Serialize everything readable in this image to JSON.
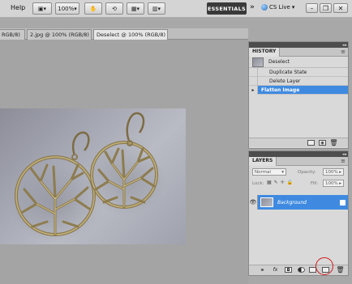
{
  "menubar": {
    "help_label": "Help",
    "zoom_value": "100%",
    "workspace_label": "ESSENTIALS",
    "more_label": "»",
    "cslive_label": "CS Live"
  },
  "tabs": [
    {
      "label": "RGB/8)",
      "close": "×"
    },
    {
      "label": "2.jpg @ 100% (RGB/8)",
      "close": "×"
    },
    {
      "label": "Deselect @ 100% (RGB/8)",
      "close": "×"
    }
  ],
  "history": {
    "title": "HISTORY",
    "snapshot_label": "Deselect",
    "items": [
      {
        "label": "Duplicate State"
      },
      {
        "label": "Delete Layer"
      },
      {
        "label": "Flatten Image"
      }
    ]
  },
  "layers": {
    "title": "LAYERS",
    "blend_mode": "Normal",
    "opacity_label": "Opacity:",
    "opacity_value": "100%",
    "lock_label": "Lock:",
    "fill_label": "Fill:",
    "fill_value": "100%",
    "layer_name": "Background"
  },
  "colors": {
    "selection_blue": "#3f8ae0",
    "annotation_red": "#d21a1a"
  }
}
